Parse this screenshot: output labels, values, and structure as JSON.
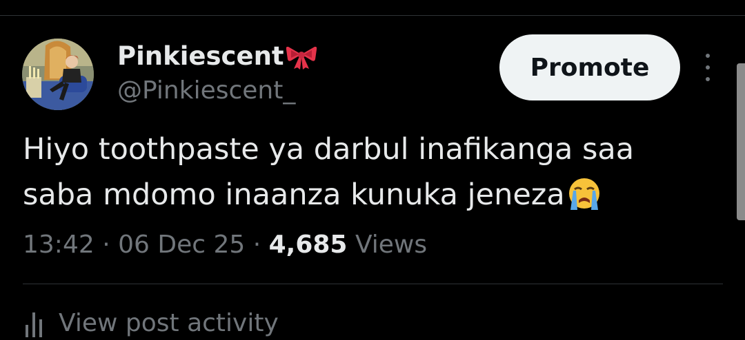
{
  "post": {
    "author": {
      "display_name": "Pinkiescent",
      "display_name_emoji": "bow-icon",
      "handle": "@Pinkiescent_",
      "avatar": "avatar"
    },
    "promote_label": "Promote",
    "more_icon": "more-vertical-icon",
    "text_lines": [
      "Hiyo toothpaste ya darbul inafikanga saa",
      "saba mdomo inaanza kunuka jeneza"
    ],
    "text_emoji": "loudly-crying-face-icon",
    "time": "13:42",
    "separator": " · ",
    "date": "06 Dec 25",
    "views_count": "4,685",
    "views_label": "Views",
    "activity_icon": "bar-chart-icon",
    "activity_label": "View post activity"
  },
  "colors": {
    "background": "#000000",
    "text_primary": "#e7e9ea",
    "text_secondary": "#71767b",
    "divider": "#2f3336",
    "button_bg": "#eff3f4",
    "button_text": "#0f1419"
  }
}
